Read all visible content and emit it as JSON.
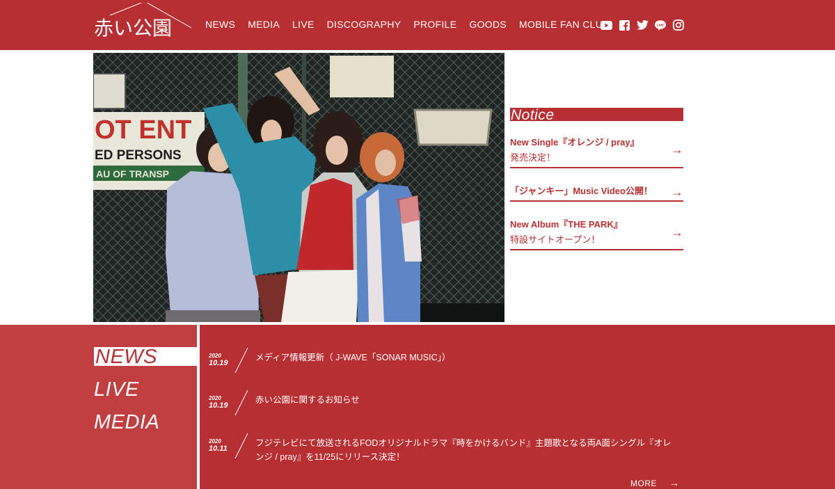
{
  "header": {
    "logo_text": "赤い公園",
    "nav": [
      "NEWS",
      "MEDIA",
      "LIVE",
      "DISCOGRAPHY",
      "PROFILE",
      "GOODS",
      "MOBILE FAN CLUB"
    ],
    "social_icons": [
      "youtube-icon",
      "facebook-icon",
      "twitter-icon",
      "line-icon",
      "instagram-icon"
    ]
  },
  "notice": {
    "title": "Notice",
    "items": [
      {
        "line1": "New Single『オレンジ / pray』",
        "line2": "発売決定！"
      },
      {
        "line1": "「ジャンキー」Music Video公開！",
        "line2": ""
      },
      {
        "line1": "New Album『THE PARK』",
        "line2": "特設サイトオープン！"
      }
    ],
    "arrow": "→"
  },
  "tabs": [
    "NEWS",
    "LIVE",
    "MEDIA"
  ],
  "news": [
    {
      "year": "2020",
      "date": "10.19",
      "text": "メディア情報更新（ J-WAVE「SONAR MUSIC」）"
    },
    {
      "year": "2020",
      "date": "10.19",
      "text": "赤い公園に関するお知らせ"
    },
    {
      "year": "2020",
      "date": "10.11",
      "text": "フジテレビにて放送されるFODオリジナルドラマ『時をかけるバンド』主題歌となる両A面シングル『オレンジ / pray』を11/25にリリース決定！"
    }
  ],
  "more_label": "MORE",
  "colors": {
    "brand": "#b82f33",
    "panel": "#c13e41",
    "white": "#ffffff"
  }
}
